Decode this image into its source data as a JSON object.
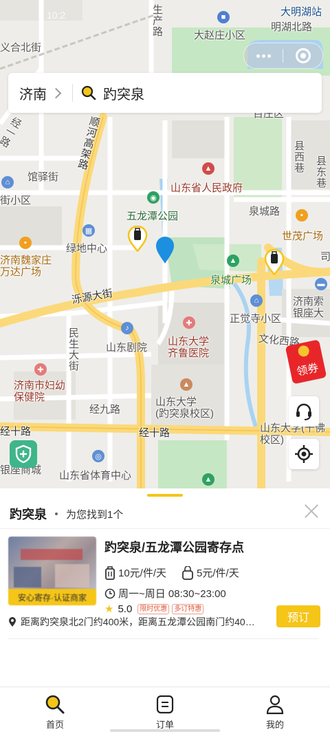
{
  "status": {
    "time": "10:2"
  },
  "search": {
    "city": "济南",
    "query": "趵突泉"
  },
  "map": {
    "labels": {
      "damingstation": "大明湖站",
      "lake_north": "明湖北路",
      "dazhaozhuang": "大赵庄小区",
      "shengchan": "生产路",
      "beiyuan": "义合北街",
      "jingyi": "经一路",
      "shunhe": "顺河高架路",
      "guanyi": "馆驿街",
      "jiexiaoqu": "街小区",
      "shengfu": "山东省人民政府",
      "wulongtan": "五龙潭公园",
      "quancheng_road": "泉城路",
      "shimao": "世茂广场",
      "lvdi": "绿地中心",
      "wanda": "济南魏家庄\n万达广场",
      "quancheng_square": "泉城广场",
      "luoyuan": "泺源大街",
      "zhengjue": "正觉寺小区",
      "jinan_suo": "济南索\n银座大",
      "wenhua": "文化西路",
      "minsheng": "民生大街",
      "juyuan": "山东剧院",
      "qilu": "山东大学\n齐鲁医院",
      "fuyou": "济南市妇幼\n保健院",
      "jingjiu": "经九路",
      "sdu": "山东大学\n(趵突泉校区)",
      "jingshi_l": "经十路",
      "jingshi_r": "经十路",
      "sdu_right": "山东大学(千佛\n校区)",
      "tiyu": "山东省体育中心",
      "yinzuo": "银座商城",
      "xianxi": "县西巷",
      "xiandong": "县东巷",
      "si": "司",
      "baizhuang": "百庄区"
    }
  },
  "redpack": {
    "label": "领券"
  },
  "sheet": {
    "keyword": "趵突泉",
    "found": "为您找到1个",
    "result": {
      "badge": "安心寄存·认证商家",
      "title": "趵突泉/五龙潭公园寄存点",
      "price_large": "10元/件/天",
      "price_small": "5元/件/天",
      "hours": "周一~周日 08:30~23:00",
      "rating": "5.0",
      "tags": [
        "限时优惠",
        "多订特惠"
      ],
      "address": "距离趵突泉北2门约400米，距离五龙潭公园南门约40…",
      "book": "预订"
    }
  },
  "tabs": [
    {
      "label": "首页",
      "icon": "search-icon"
    },
    {
      "label": "订单",
      "icon": "order-icon"
    },
    {
      "label": "我的",
      "icon": "user-icon"
    }
  ],
  "colors": {
    "accent": "#f5c518",
    "pin": "#1d8fe1",
    "park": "#bfe3c0",
    "water": "#a9d3f2",
    "road": "#fbd97a"
  }
}
